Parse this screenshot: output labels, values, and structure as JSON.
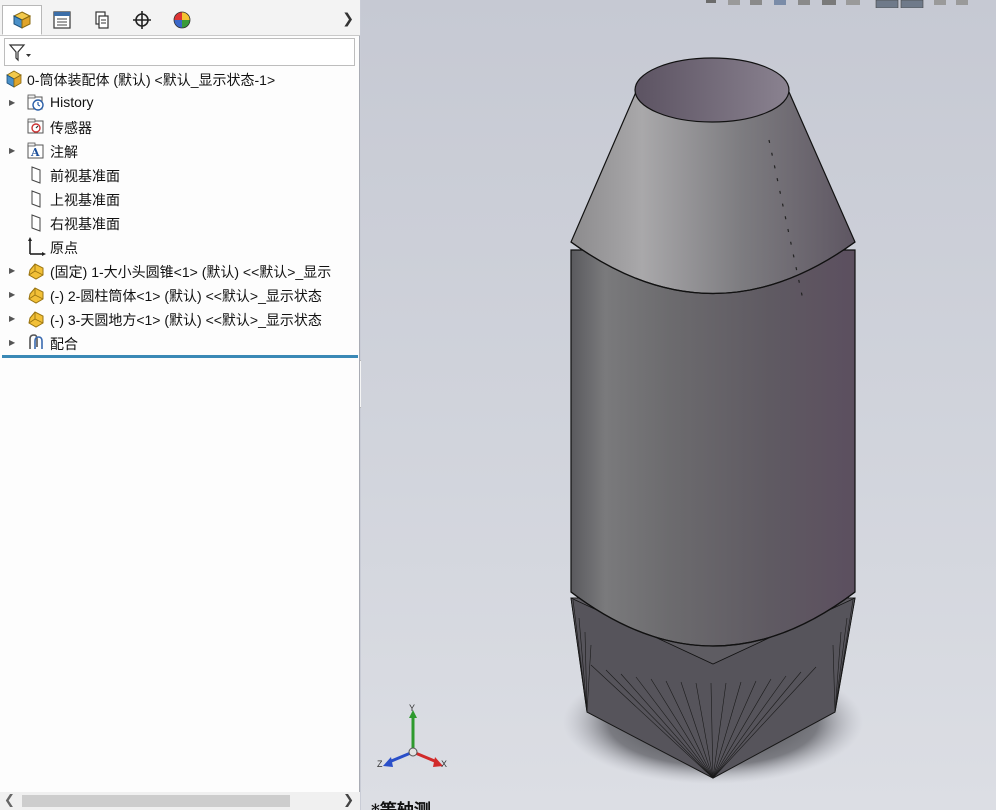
{
  "tabs": [
    {
      "name": "feature-manager",
      "icon": "feature-manager-icon"
    },
    {
      "name": "property-manager",
      "icon": "property-manager-icon"
    },
    {
      "name": "configuration-manager",
      "icon": "configuration-manager-icon"
    },
    {
      "name": "dimxpert-manager",
      "icon": "dimxpert-icon"
    },
    {
      "name": "display-manager",
      "icon": "display-manager-icon"
    }
  ],
  "filter": {
    "icon": "filter-icon"
  },
  "tree": {
    "root": "0-筒体装配体 (默认) <默认_显示状态-1>",
    "history": "History",
    "sensors": "传感器",
    "annotations": "注解",
    "front_plane": "前视基准面",
    "top_plane": "上视基准面",
    "right_plane": "右视基准面",
    "origin": "原点",
    "comp1": "(固定) 1-大小头圆锥<1> (默认) <<默认>_显示",
    "comp2": "(-) 2-圆柱筒体<1> (默认) <<默认>_显示状态",
    "comp3": "(-) 3-天圆地方<1> (默认) <<默认>_显示状态",
    "mates": "配合"
  },
  "viewport": {
    "view_label": "*等轴测",
    "triad": {
      "x": "X",
      "y": "Y",
      "z": "Z"
    }
  },
  "colors": {
    "accent": "#3a89b6",
    "part_yellow": "#e8b43a",
    "model_gray": "#6e6c74"
  }
}
